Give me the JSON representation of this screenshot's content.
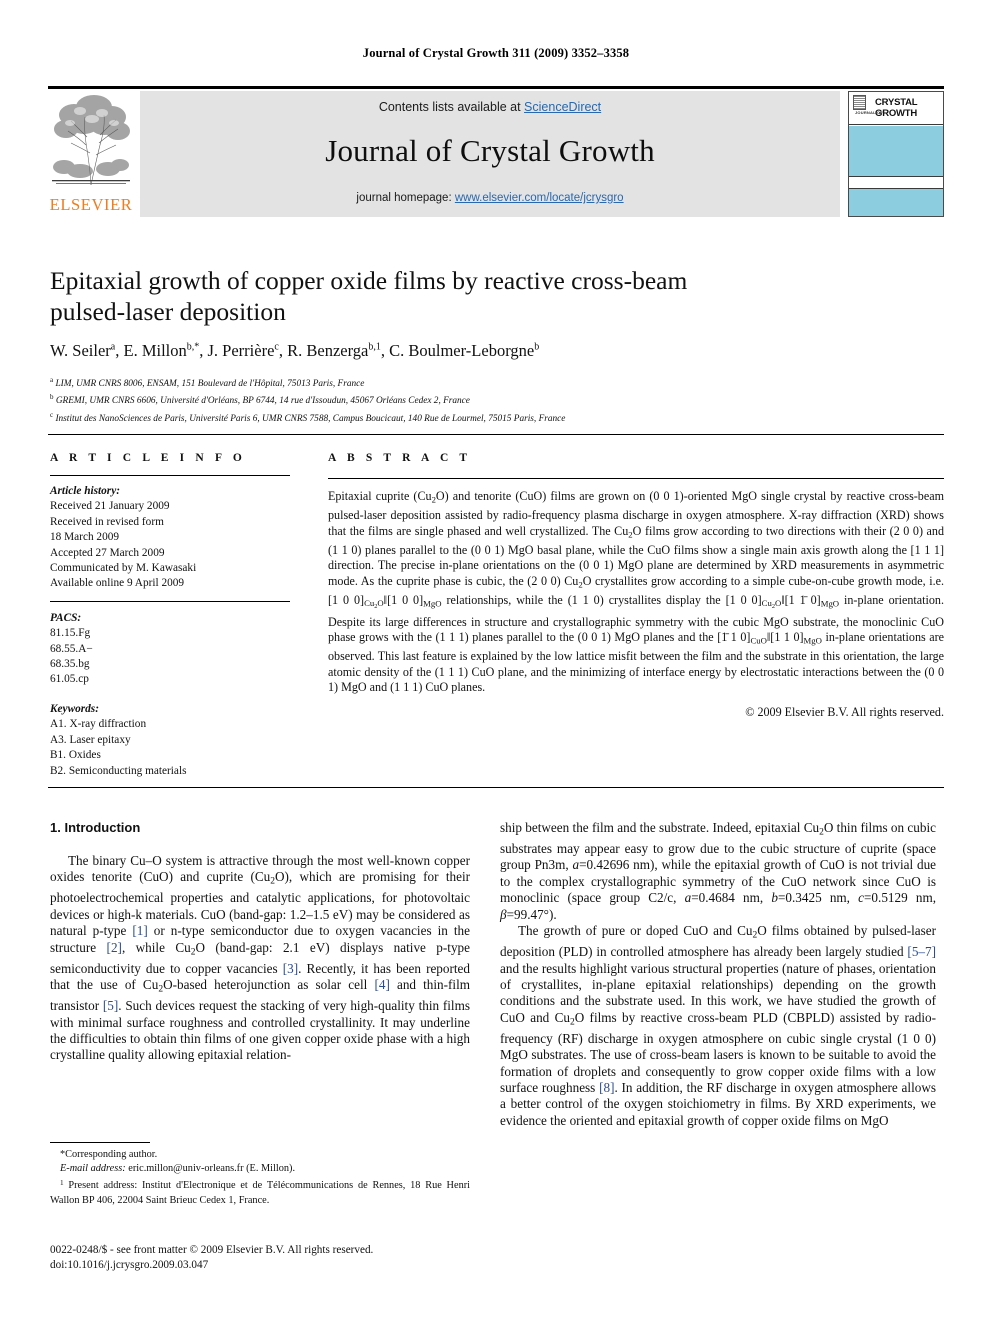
{
  "running_head": "Journal of Crystal Growth 311 (2009) 3352–3358",
  "masthead": {
    "contents_prefix": "Contents lists available at ",
    "sciencedirect": "ScienceDirect",
    "journal_title": "Journal of Crystal Growth",
    "homepage_prefix": "journal homepage: ",
    "homepage_url": "www.elsevier.com/locate/jcrysgro",
    "publisher": "ELSEVIER",
    "cover": {
      "journal_of": "JOURNAL OF",
      "title": "CRYSTAL GROWTH",
      "accent_color": "#8ccde0"
    },
    "link_color": "#2768b0",
    "band_color": "#e3e3e3"
  },
  "article": {
    "title": "Epitaxial growth of copper oxide films by reactive cross-beam pulsed-laser deposition",
    "authors_html": "W. Seiler<sup>a</sup>, E. Millon<sup>b,*</sup>, J. Perrière<sup>c</sup>, R. Benzerga<sup>b,1</sup>, C. Boulmer-Leborgne<sup>b</sup>",
    "affiliations": [
      "a LIM, UMR CNRS 8006, ENSAM, 151 Boulevard de l'Hôpital, 75013 Paris, France",
      "b GREMI, UMR CNRS 6606, Université d'Orléans, BP 6744, 14 rue d'Issoudun, 45067 Orléans Cedex 2, France",
      "c Institut des NanoSciences de Paris, Université Paris 6, UMR CNRS 7588, Campus Boucicaut, 140 Rue de Lourmel, 75015 Paris, France"
    ]
  },
  "article_info": {
    "heading": "A R T I C L E   I N F O",
    "history_label": "Article history:",
    "history": [
      "Received 21 January 2009",
      "Received in revised form",
      "18 March 2009",
      "Accepted 27 March 2009",
      "Communicated by M. Kawasaki",
      "Available online 9 April 2009"
    ],
    "pacs_label": "PACS:",
    "pacs": [
      "81.15.Fg",
      "68.55.A−",
      "68.35.bg",
      "61.05.cp"
    ],
    "keywords_label": "Keywords:",
    "keywords": [
      "A1. X-ray diffraction",
      "A3. Laser epitaxy",
      "B1. Oxides",
      "B2. Semiconducting materials"
    ]
  },
  "abstract": {
    "heading": "A B S T R A C T",
    "body_html": "Epitaxial cuprite (Cu<sub>2</sub>O) and tenorite (CuO) films are grown on (0 0 1)-oriented MgO single crystal by reactive cross-beam pulsed-laser deposition assisted by radio-frequency plasma discharge in oxygen atmosphere. X-ray diffraction (XRD) shows that the films are single phased and well crystallized. The Cu<sub>2</sub>O films grow according to two directions with their (2 0 0) and (1 1 0) planes parallel to the (0 0 1) MgO basal plane, while the CuO films show a single main axis growth along the [1 1 1] direction. The precise in-plane orientations on the (0 0 1) MgO plane are determined by XRD measurements in asymmetric mode. As the cuprite phase is cubic, the (2 0 0) Cu<sub>2</sub>O crystallites grow according to a simple cube-on-cube growth mode, i.e. [1 0 0]<sub>Cu<sub>2</sub>O</sub>‖[1 0 0]<sub>MgO</sub> relationships, while the (1 1 0) crystallites display the [1 0 0]<sub>Cu<sub>2</sub>O</sub>‖[1 1̄ 0]<sub>MgO</sub> in-plane orientation. Despite its large differences in structure and crystallographic symmetry with the cubic MgO substrate, the monoclinic CuO phase grows with the (1 1 1) planes parallel to the (0 0 1) MgO planes and the [1̄ 1 0]<sub>CuO</sub>‖[1 1 0]<sub>MgO</sub> in-plane orientations are observed. This last feature is explained by the low lattice misfit between the film and the substrate in this orientation, the large atomic density of the (1 1 1) CuO plane, and the minimizing of interface energy by electrostatic interactions between the (0 0 1) MgO and (1 1 1) CuO planes.",
    "copyright": "© 2009 Elsevier B.V. All rights reserved."
  },
  "introduction": {
    "heading": "1. Introduction",
    "left_html": "The binary Cu–O system is attractive through the most well-known copper oxides tenorite (CuO) and cuprite (Cu<sub>2</sub>O), which are promising for their photoelectrochemical properties and catalytic applications, for photovoltaic devices or high-k materials. CuO (band-gap: 1.2–1.5 eV) may be considered as natural p-type <span class=\"ref\">[1]</span> or n-type semiconductor due to oxygen vacancies in the structure <span class=\"ref\">[2]</span>, while Cu<sub>2</sub>O (band-gap: 2.1 eV) displays native p-type semiconductivity due to copper vacancies <span class=\"ref\">[3]</span>. Recently, it has been reported that the use of Cu<sub>2</sub>O-based heterojunction as solar cell <span class=\"ref\">[4]</span> and thin-film transistor <span class=\"ref\">[5]</span>. Such devices request the stacking of very high-quality thin films with minimal surface roughness and controlled crystallinity. It may underline the difficulties to obtain thin films of one given copper oxide phase with a high crystalline quality allowing epitaxial relation-",
    "right_html_1": "ship between the film and the substrate. Indeed, epitaxial Cu<sub>2</sub>O thin films on cubic substrates may appear easy to grow due to the cubic structure of cuprite (space group Pn3m, <em>a</em>=0.42696 nm), while the epitaxial growth of CuO is not trivial due to the complex crystallographic symmetry of the CuO network since CuO is monoclinic (space group C2/c, <em>a</em>=0.4684 nm, <em>b</em>=0.3425 nm, <em>c</em>=0.5129 nm, <em>β</em>=99.47°).",
    "right_html_2": "The growth of pure or doped CuO and Cu<sub>2</sub>O films obtained by pulsed-laser deposition (PLD) in controlled atmosphere has already been largely studied <span class=\"ref\">[5–7]</span> and the results highlight various structural properties (nature of phases, orientation of crystallites, in-plane epitaxial relationships) depending on the growth conditions and the substrate used. In this work, we have studied the growth of CuO and Cu<sub>2</sub>O films by reactive cross-beam PLD (CBPLD) assisted by radio-frequency (RF) discharge in oxygen atmosphere on cubic single crystal (1 0 0) MgO substrates. The use of cross-beam lasers is known to be suitable to avoid the formation of droplets and consequently to grow copper oxide films with a low surface roughness <span class=\"ref\">[8]</span>. In addition, the RF discharge in oxygen atmosphere allows a better control of the oxygen stoichiometry in films. By XRD experiments, we evidence the oriented and epitaxial growth of copper oxide films on MgO"
  },
  "footnotes": {
    "corresponding": "*Corresponding author.",
    "email_label": "E-mail address:",
    "email": "eric.millon@univ-orleans.fr (E. Millon).",
    "present_address": "1 Present address: Institut d'Electronique et de Télécommunications de Rennes, 18 Rue Henri Wallon BP 406, 22004 Saint Brieuc Cedex 1, France."
  },
  "imprint": {
    "issn_line": "0022-0248/$ - see front matter © 2009 Elsevier B.V. All rights reserved.",
    "doi_line": "doi:10.1016/j.jcrysgro.2009.03.047"
  }
}
